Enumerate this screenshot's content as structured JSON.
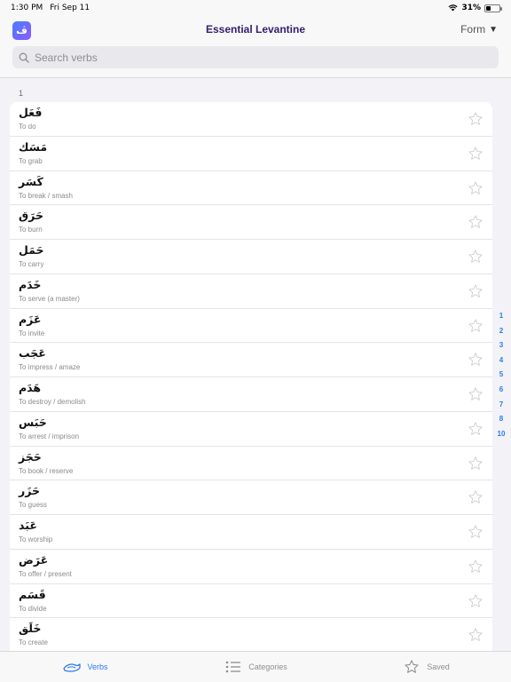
{
  "status": {
    "time": "1:30 PM",
    "date": "Fri Sep 11",
    "battery": "31%",
    "battery_level": 0.31
  },
  "header": {
    "title": "Essential Levantine",
    "app_icon_glyph": "ڤ",
    "form_label": "Form",
    "form_caret": "▼"
  },
  "search": {
    "placeholder": "Search verbs"
  },
  "section": {
    "label": "1"
  },
  "verbs": [
    {
      "arabic": "فَعَل",
      "english": "To do"
    },
    {
      "arabic": "مَسَك",
      "english": "To grab"
    },
    {
      "arabic": "كَسَر",
      "english": "To break / smash"
    },
    {
      "arabic": "حَرَق",
      "english": "To burn"
    },
    {
      "arabic": "حَمَل",
      "english": "To carry"
    },
    {
      "arabic": "خَدَم",
      "english": "To serve (a master)"
    },
    {
      "arabic": "عَزَم",
      "english": "To invite"
    },
    {
      "arabic": "عَجَب",
      "english": "To impress / amaze"
    },
    {
      "arabic": "هَدَم",
      "english": "To destroy / demolish"
    },
    {
      "arabic": "حَبَس",
      "english": "To arrest / imprison"
    },
    {
      "arabic": "حَجَز",
      "english": "To book / reserve"
    },
    {
      "arabic": "حَزَر",
      "english": "To guess"
    },
    {
      "arabic": "عَبَد",
      "english": "To worship"
    },
    {
      "arabic": "عَرَض",
      "english": "To offer / present"
    },
    {
      "arabic": "قَسَم",
      "english": "To divide"
    },
    {
      "arabic": "خَلَق",
      "english": "To create"
    }
  ],
  "section_index": [
    "1",
    "2",
    "3",
    "4",
    "5",
    "6",
    "7",
    "8",
    "10"
  ],
  "tabs": [
    {
      "label": "Verbs",
      "icon": "verbs-icon",
      "active": true
    },
    {
      "label": "Categories",
      "icon": "list-icon",
      "active": false
    },
    {
      "label": "Saved",
      "icon": "star-icon",
      "active": false
    }
  ],
  "colors": {
    "accent": "#2b7cf0",
    "title": "#35206e",
    "star": "#d0d0d4"
  }
}
